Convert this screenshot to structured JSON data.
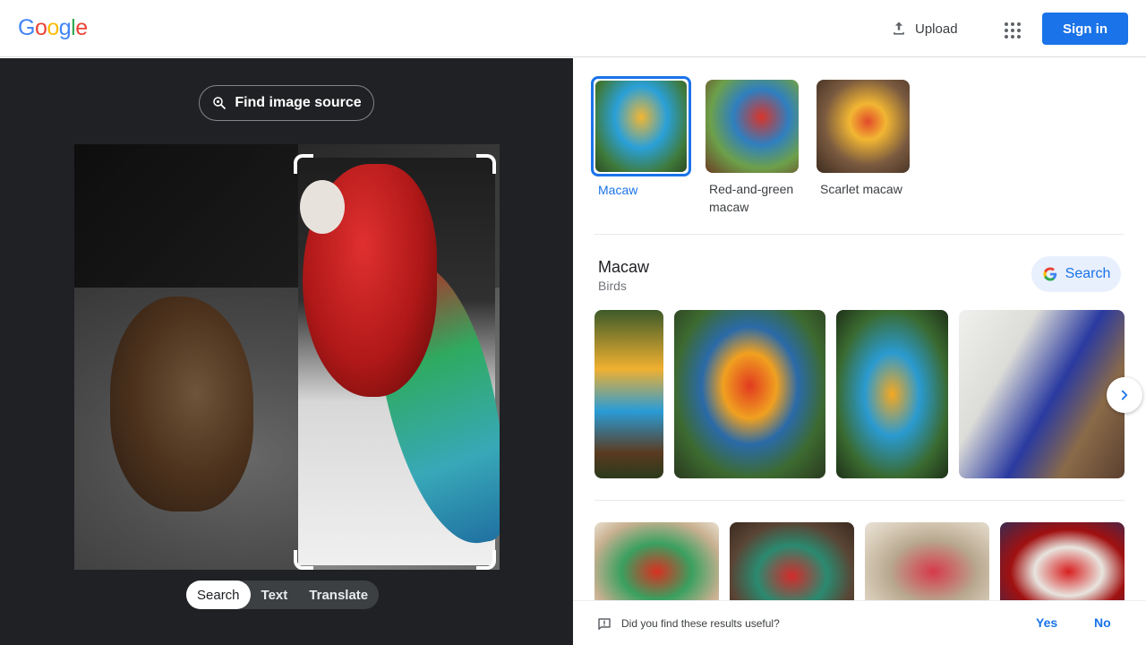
{
  "header": {
    "logo": [
      "G",
      "o",
      "o",
      "g",
      "l",
      "e"
    ],
    "logo_colors": [
      "#4285F4",
      "#EA4335",
      "#FBBC05",
      "#4285F4",
      "#34A853",
      "#EA4335"
    ],
    "upload_label": "Upload",
    "signin_label": "Sign in"
  },
  "left": {
    "find_source_label": "Find image source",
    "modes": [
      "Search",
      "Text",
      "Translate"
    ],
    "active_mode": "Search"
  },
  "right": {
    "chips": [
      {
        "label": "Macaw",
        "selected": true
      },
      {
        "label": "Red-and-green macaw",
        "selected": false
      },
      {
        "label": "Scarlet macaw",
        "selected": false
      }
    ],
    "entity": {
      "title": "Macaw",
      "subtitle": "Birds",
      "search_label": "Search"
    }
  },
  "feedback": {
    "question": "Did you find these results useful?",
    "yes_label": "Yes",
    "no_label": "No"
  },
  "colors": {
    "accent": "#1a73e8",
    "dark_panel": "#202124"
  }
}
